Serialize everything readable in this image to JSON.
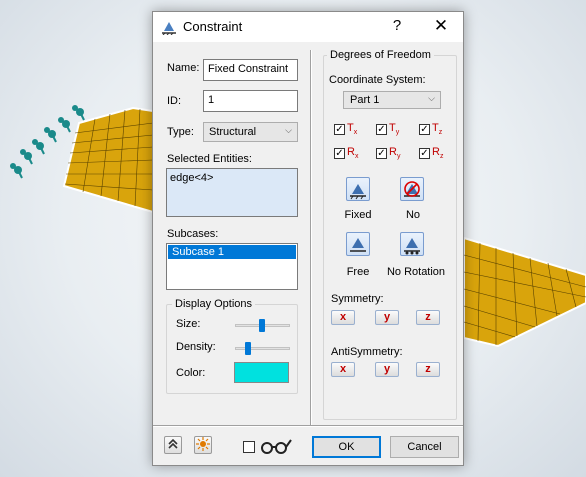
{
  "dialog": {
    "title": "Constraint",
    "help_label": "?",
    "close_label": "✕"
  },
  "left": {
    "name_label": "Name:",
    "name_value": "Fixed Constraint",
    "id_label": "ID:",
    "id_value": "1",
    "type_label": "Type:",
    "type_value": "Structural",
    "selected_label": "Selected Entities:",
    "selected_value": "edge<4>",
    "subcases_label": "Subcases:",
    "subcases": [
      "Subcase 1"
    ],
    "display": {
      "title": "Display Options",
      "size_label": "Size:",
      "size_level": 0.48,
      "density_label": "Density:",
      "density_level": 0.2,
      "color_label": "Color:",
      "color": "#00e1df"
    }
  },
  "dof": {
    "title": "Degrees of Freedom",
    "coord_label": "Coordinate System:",
    "coord_value": "Part 1",
    "checks": [
      {
        "main": "T",
        "sub": "x",
        "checked": true
      },
      {
        "main": "T",
        "sub": "y",
        "checked": true
      },
      {
        "main": "T",
        "sub": "z",
        "checked": true
      },
      {
        "main": "R",
        "sub": "x",
        "checked": true
      },
      {
        "main": "R",
        "sub": "y",
        "checked": true
      },
      {
        "main": "R",
        "sub": "z",
        "checked": true
      }
    ],
    "presets": {
      "fixed": "Fixed",
      "no": "No",
      "free": "Free",
      "no_rotation": "No Rotation"
    },
    "symmetry_label": "Symmetry:",
    "antisymmetry_label": "AntiSymmetry:",
    "axes": [
      "x",
      "y",
      "z"
    ]
  },
  "footer": {
    "ok": "OK",
    "cancel": "Cancel"
  },
  "colors": {
    "plate": "#d9a40c",
    "marker": "#1a8a8a",
    "accent": "#0078d7"
  }
}
